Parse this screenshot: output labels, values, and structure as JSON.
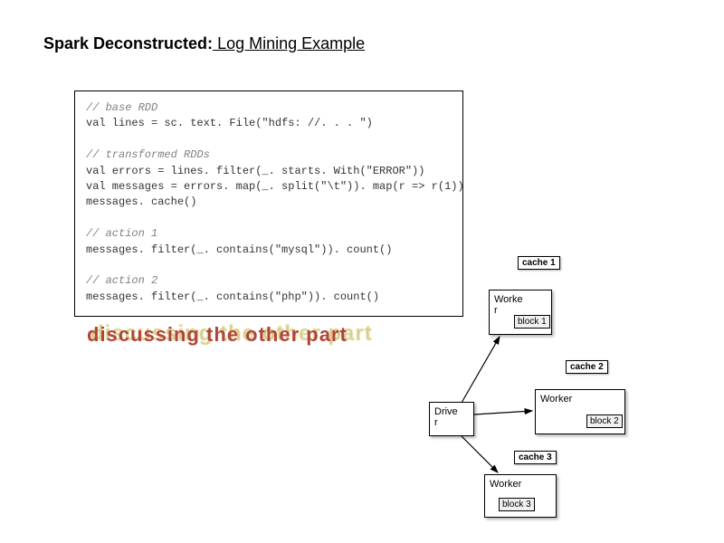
{
  "title": {
    "bold": "Spark Deconstructed:",
    "rest": " Log Mining Example"
  },
  "code": {
    "c1": "// base RDD",
    "l1": "val lines = sc. text. File(\"hdfs: //. . . \")",
    "c2": "// transformed RDDs",
    "l2": "val errors = lines. filter(_. starts. With(\"ERROR\"))",
    "l3": "val messages = errors. map(_. split(\"\\t\")). map(r => r(1))",
    "l4": "messages. cache()",
    "c3": "// action 1",
    "l5": "messages. filter(_. contains(\"mysql\")). count()",
    "c4": "// action 2",
    "l6": "messages. filter(_. contains(\"php\")). count()"
  },
  "overlay": {
    "back": "discussing the other part",
    "front": "discussing the other part"
  },
  "labels": {
    "cache1": "cache 1",
    "cache2": "cache 2",
    "cache3": "cache 3",
    "worker1a": "Worke",
    "worker1b": "r",
    "worker2": "Worker",
    "worker3": "Worker",
    "block1": "block 1",
    "block2": "block 2",
    "block3": "block 3",
    "driver_a": "Drive",
    "driver_b": "r"
  }
}
